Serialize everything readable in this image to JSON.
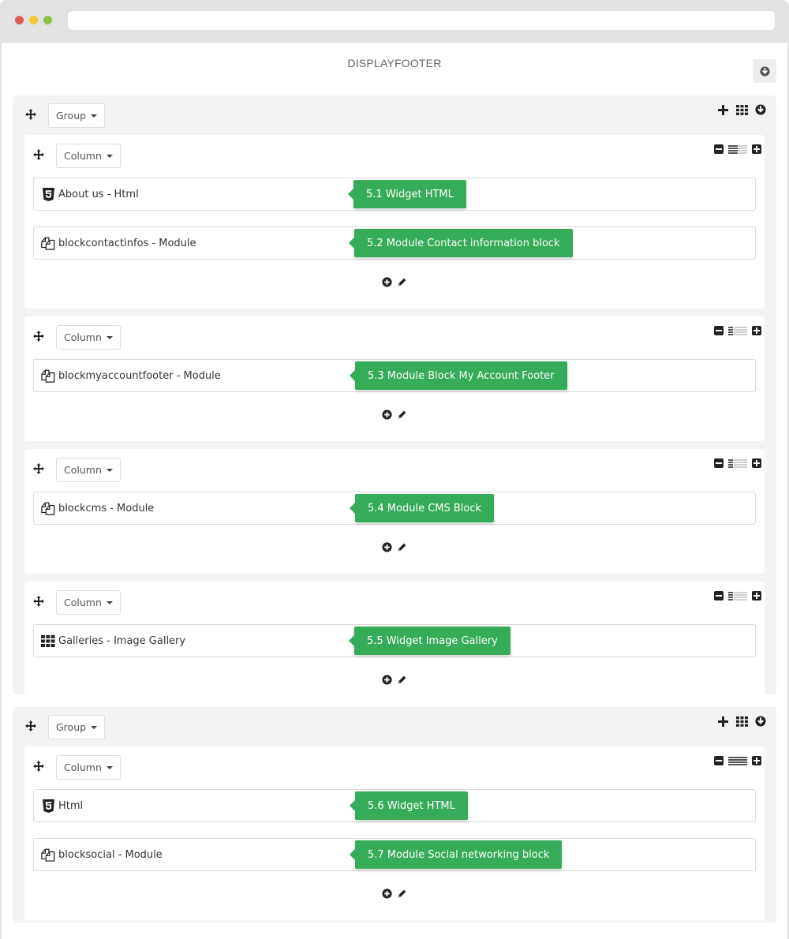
{
  "window": {
    "controls": [
      "close",
      "minimize",
      "maximize"
    ],
    "address_bar": ""
  },
  "hook": {
    "title": "DISPLAYFOOTER",
    "toggle_icon": "arrow-circle-down-icon"
  },
  "colors": {
    "callout": "#36ab58",
    "group_bg": "#f3f3f3",
    "column_bg": "#ffffff",
    "icon": "#222222"
  },
  "groups": [
    {
      "label": "Group",
      "tools": [
        "plus-icon",
        "grid-icon",
        "arrow-circle-down-icon"
      ],
      "columns": [
        {
          "label": "Column",
          "width_twelfths": 6,
          "blocks": [
            {
              "icon": "html5-icon",
              "label": "About us - Html",
              "callout": "5.1 Widget HTML"
            },
            {
              "icon": "module-icon",
              "label": "blockcontactinfos - Module",
              "callout": "5.2 Module Contact information block"
            }
          ]
        },
        {
          "label": "Column",
          "width_twelfths": 3,
          "blocks": [
            {
              "icon": "module-icon",
              "label": "blockmyaccountfooter - Module",
              "callout": "5.3 Module Block My Account Footer"
            }
          ]
        },
        {
          "label": "Column",
          "width_twelfths": 3,
          "blocks": [
            {
              "icon": "module-icon",
              "label": "blockcms - Module",
              "callout": "5.4 Module CMS Block"
            }
          ]
        },
        {
          "label": "Column",
          "width_twelfths": 3,
          "blocks": [
            {
              "icon": "gallery-icon",
              "label": "Galleries - Image Gallery",
              "callout": "5.5 Widget Image Gallery"
            }
          ]
        }
      ]
    },
    {
      "label": "Group",
      "tools": [
        "plus-icon",
        "grid-icon",
        "arrow-circle-down-icon"
      ],
      "columns": [
        {
          "label": "Column",
          "width_twelfths": 12,
          "blocks": [
            {
              "icon": "html5-icon",
              "label": "Html",
              "callout": "5.6 Widget HTML"
            },
            {
              "icon": "module-icon",
              "label": "blocksocial - Module",
              "callout": "5.7 Module Social networking block"
            }
          ]
        }
      ]
    }
  ]
}
